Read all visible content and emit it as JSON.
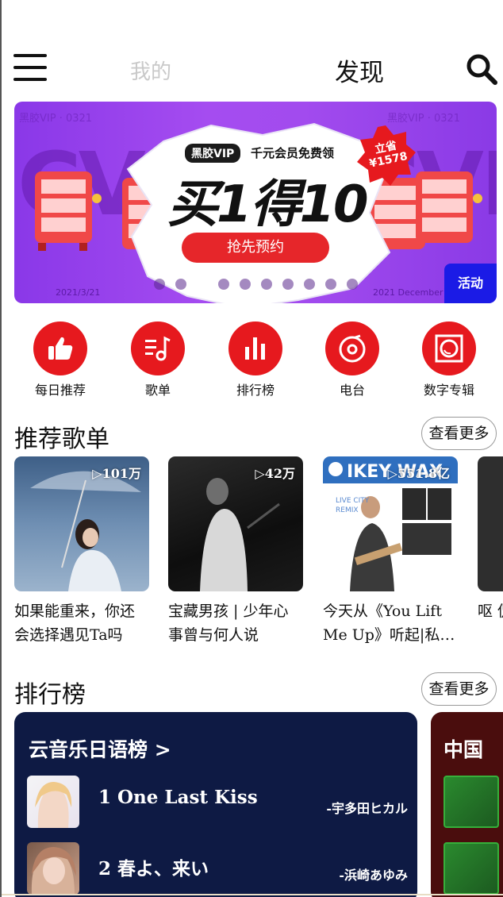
{
  "header": {
    "tab_mine": "我的",
    "tab_discover": "发现",
    "menu_icon": "hamburger-menu-icon",
    "search_icon": "search-icon"
  },
  "banner": {
    "vip_tag": "黑胶VIP",
    "subtitle": "千元会员免费领",
    "title": "买1得10",
    "cta": "抢先预约",
    "badge": "立省 ¥1578",
    "stamp_left": "黑胶VIP · 0321",
    "stamp_right": "黑胶VIP · 0321",
    "date_left": "2021/3/21",
    "date_right": "2021 December",
    "tag": "活动",
    "slide_count": 10,
    "active_slide": 3,
    "colors": {
      "bg": "#9a44ee",
      "cta": "#e6262a",
      "tag": "#1b1be6"
    }
  },
  "quicknav": [
    {
      "label": "每日推荐",
      "icon": "thumbs-up-icon"
    },
    {
      "label": "歌单",
      "icon": "playlist-music-icon"
    },
    {
      "label": "排行榜",
      "icon": "bar-chart-icon"
    },
    {
      "label": "电台",
      "icon": "radio-disc-icon"
    },
    {
      "label": "数字专辑",
      "icon": "vinyl-album-icon"
    }
  ],
  "recommended": {
    "title": "推荐歌单",
    "more": "查看更多",
    "playlists": [
      {
        "count": "▷101万",
        "title": "如果能重来，你还会选择遇见Ta吗"
      },
      {
        "count": "▷42万",
        "title": "宝藏男孩 | 少年心事曾与何人说"
      },
      {
        "count": "▷551.8亿",
        "title": "今天从《You Lift Me Up》听起|私…"
      },
      {
        "count": "",
        "title": "呕 侃"
      }
    ]
  },
  "charts": {
    "title": "排行榜",
    "more": "查看更多",
    "cards": [
      {
        "name": "云音乐日语榜 >",
        "entries": [
          {
            "song": "1 One Last Kiss",
            "artist": "-宇多田ヒカル"
          },
          {
            "song": "2 春よ、来い",
            "artist": "-浜崎あゆみ"
          }
        ]
      },
      {
        "name": "中国"
      }
    ]
  }
}
